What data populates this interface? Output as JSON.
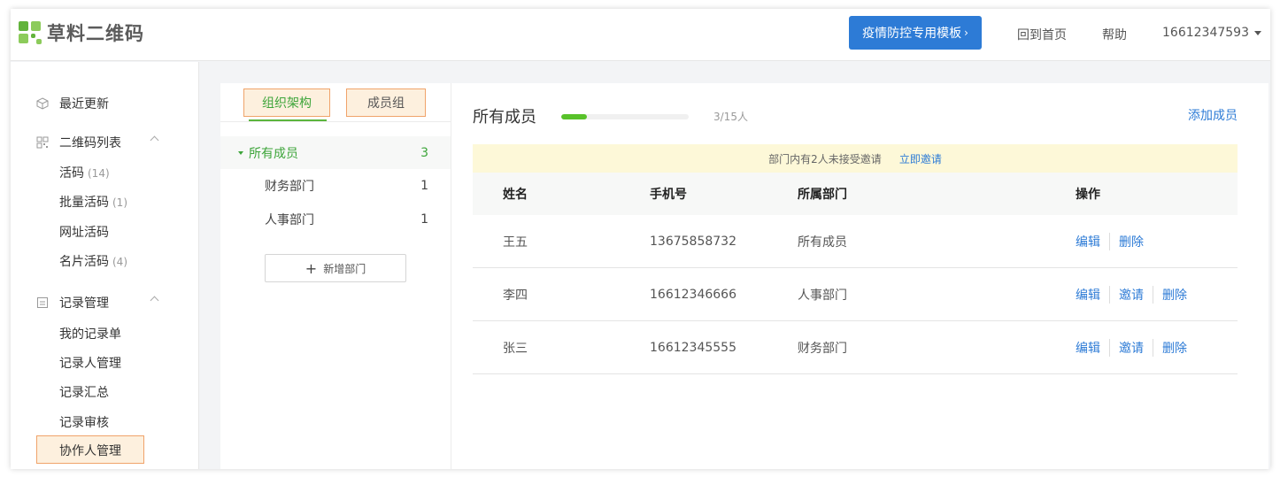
{
  "header": {
    "logo_text": "草料二维码",
    "promo_button": "疫情防控专用模板",
    "home_link": "回到首页",
    "help_link": "帮助",
    "user_phone": "16612347593"
  },
  "sidebar": {
    "recent": "最近更新",
    "qr_list": {
      "label": "二维码列表",
      "items": [
        {
          "label": "活码",
          "count": "(14)"
        },
        {
          "label": "批量活码",
          "count": "(1)"
        },
        {
          "label": "网址活码",
          "count": ""
        },
        {
          "label": "名片活码",
          "count": "(4)"
        }
      ]
    },
    "records": {
      "label": "记录管理",
      "items": [
        {
          "label": "我的记录单"
        },
        {
          "label": "记录人管理"
        },
        {
          "label": "记录汇总"
        },
        {
          "label": "记录审核"
        },
        {
          "label": "协作人管理"
        }
      ]
    }
  },
  "org": {
    "tabs": [
      "组织架构",
      "成员组"
    ],
    "tree": [
      {
        "label": "所有成员",
        "count": "3"
      },
      {
        "label": "财务部门",
        "count": "1"
      },
      {
        "label": "人事部门",
        "count": "1"
      }
    ],
    "add_dept": "新增部门"
  },
  "main": {
    "title": "所有成员",
    "progress_fraction": 0.2,
    "progress_text": "3/15人",
    "add_member": "添加成员",
    "notice_text": "部门内有2人未接受邀请",
    "notice_action": "立即邀请",
    "columns": [
      "姓名",
      "手机号",
      "所属部门",
      "操作"
    ],
    "rows": [
      {
        "name": "王五",
        "phone": "13675858732",
        "dept": "所有成员",
        "ops": [
          "编辑",
          "删除"
        ]
      },
      {
        "name": "李四",
        "phone": "16612346666",
        "dept": "人事部门",
        "ops": [
          "编辑",
          "邀请",
          "删除"
        ]
      },
      {
        "name": "张三",
        "phone": "16612345555",
        "dept": "财务部门",
        "ops": [
          "编辑",
          "邀请",
          "删除"
        ]
      }
    ]
  },
  "colors": {
    "brand_green": "#3da53a",
    "link_blue": "#2d7bd6",
    "promo_blue": "#2d7bd6",
    "highlight_fill": "#fdf0de",
    "highlight_border": "#f0a36a"
  }
}
